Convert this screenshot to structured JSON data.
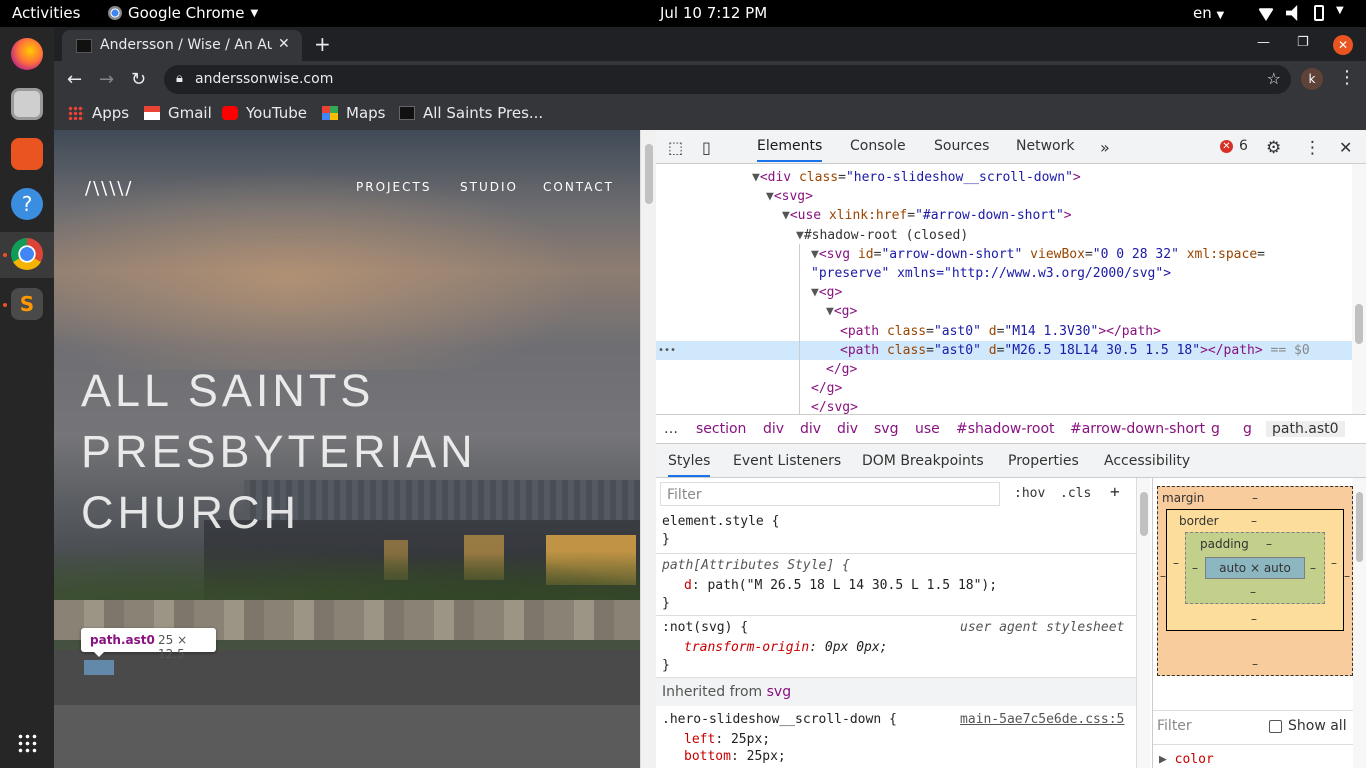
{
  "system_bar": {
    "activities": "Activities",
    "app_name": "Google Chrome",
    "clock": "Jul 10  7:12 PM",
    "language": "en"
  },
  "browser": {
    "tab_title": "Andersson / Wise / An Au",
    "url": "anderssonwise.com",
    "profile_initial": "k",
    "bookmarks": [
      {
        "label": "Apps"
      },
      {
        "label": "Gmail"
      },
      {
        "label": "YouTube"
      },
      {
        "label": "Maps"
      },
      {
        "label": "All Saints Pres..."
      }
    ]
  },
  "site": {
    "logo": "/\\\\\\\\/",
    "nav": [
      "PROJECTS",
      "STUDIO",
      "CONTACT"
    ],
    "hero_lines": [
      "ALL SAINTS",
      "PRESBYTERIAN",
      "CHURCH"
    ],
    "tooltip_name": "path.ast0",
    "tooltip_dims": "25 × 12.5"
  },
  "devtools": {
    "tabs": [
      "Elements",
      "Console",
      "Sources",
      "Network"
    ],
    "error_count": "6",
    "dom_lines": [
      {
        "indent": 0,
        "pre": "▼<",
        "tag": "div",
        "attrs": [
          [
            "class",
            "hero-slideshow__scroll-down"
          ]
        ],
        "post": ">"
      },
      {
        "indent": 1,
        "pre": "▼<",
        "tag": "svg",
        "attrs": [],
        "post": ">"
      },
      {
        "indent": 2,
        "pre": "▼<",
        "tag": "use",
        "attrs": [
          [
            "xlink:href",
            "#arrow-down-short"
          ]
        ],
        "post": ">"
      },
      {
        "indent": 3,
        "pre": "▼",
        "tag": "",
        "text": "#shadow-root (closed)",
        "attrs": [],
        "post": ""
      },
      {
        "indent": 4,
        "pre": "▼<",
        "tag": "svg",
        "attrs": [
          [
            "id",
            "arrow-down-short"
          ],
          [
            "viewBox",
            "0 0 28 32"
          ],
          [
            "xml:space",
            ""
          ]
        ],
        "post": ""
      },
      {
        "indent": 4,
        "pre": "",
        "tag": "",
        "text": "\"preserve\" xmlns=\"http://www.w3.org/2000/svg\">",
        "attrs": [],
        "post": ""
      },
      {
        "indent": 5,
        "pre": "▼<",
        "tag": "g",
        "attrs": [],
        "post": ">"
      },
      {
        "indent": 6,
        "pre": "▼<",
        "tag": "g",
        "attrs": [],
        "post": ">"
      },
      {
        "indent": 7,
        "pre": "<",
        "tag": "path",
        "attrs": [
          [
            "class",
            "ast0"
          ],
          [
            "d",
            "M14 1.3V30"
          ]
        ],
        "post": "></path>"
      },
      {
        "indent": 7,
        "pre": "<",
        "tag": "path",
        "attrs": [
          [
            "class",
            "ast0"
          ],
          [
            "d",
            "M26.5 18L14 30.5 1.5 18"
          ]
        ],
        "post": "></path> == $0",
        "selected": true
      },
      {
        "indent": 6,
        "pre": "</",
        "tag": "g",
        "attrs": [],
        "post": ">"
      },
      {
        "indent": 5,
        "pre": "</",
        "tag": "g",
        "attrs": [],
        "post": ">"
      },
      {
        "indent": 4,
        "pre": "</",
        "tag": "svg",
        "attrs": [],
        "post": ">"
      }
    ],
    "breadcrumbs": [
      "section",
      "div",
      "div",
      "div",
      "svg",
      "use",
      "#shadow-root",
      "#arrow-down-short",
      "g",
      "g",
      "path.ast0"
    ],
    "sub_tabs": [
      "Styles",
      "Event Listeners",
      "DOM Breakpoints",
      "Properties",
      "Accessibility"
    ],
    "filter_placeholder": "Filter",
    "hov": ":hov",
    "cls": ".cls",
    "styles": {
      "element_style": "element.style {",
      "attr_style_selector": "path[Attributes Style] {",
      "d_prop": "d",
      "d_value": "path(\"M 26.5 18 L 14 30.5 L 1.5 18\");",
      "ua_selector": ":not(svg) {",
      "ua_label": "user agent stylesheet",
      "transform_prop": "transform-origin",
      "transform_value": "0px 0px;",
      "inherited_from": "Inherited from",
      "inherited_elem": "svg",
      "hero_selector": ".hero-slideshow__scroll-down {",
      "hero_source": "main-5ae7c5e6de.css:5",
      "left_prop": "left",
      "left_value": "25px;",
      "bottom_prop": "bottom",
      "bottom_value": "25px;",
      "close_brace": "}"
    },
    "box_model": {
      "margin": "margin",
      "border": "border",
      "padding": "padding",
      "content": "auto × auto",
      "dash": "–",
      "filter": "Filter",
      "show_all": "Show all",
      "color_prop": "color"
    }
  }
}
